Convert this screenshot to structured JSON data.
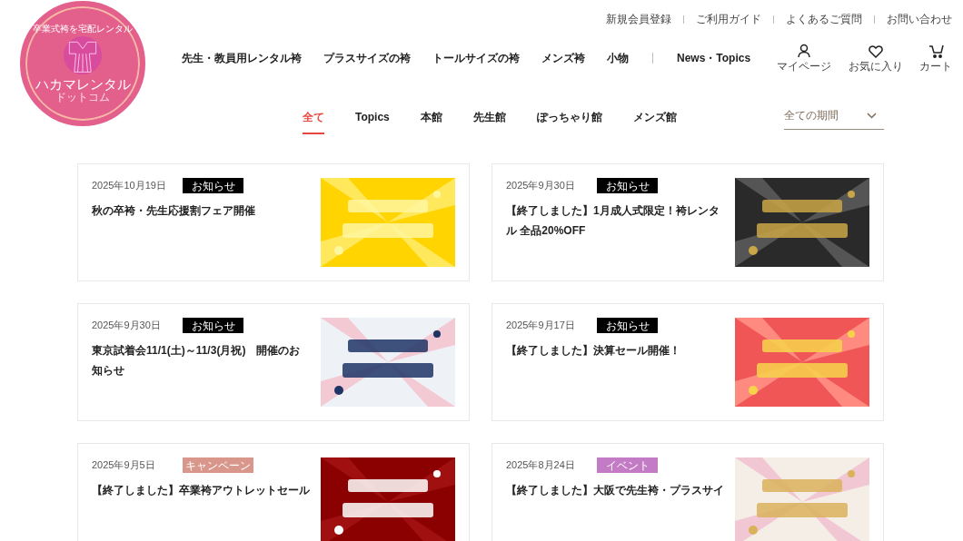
{
  "logo": {
    "tagline": "卒業式袴を宅配レンタル",
    "name": "ハカマレンタル",
    "sub": "ドットコム"
  },
  "utility_links": [
    "新規会員登録",
    "ご利用ガイド",
    "よくあるご質問",
    "お問い合わせ"
  ],
  "main_nav": [
    "先生・教員用レンタル袴",
    "プラスサイズの袴",
    "トールサイズの袴",
    "メンズ袴",
    "小物"
  ],
  "secondary_nav": [
    "News・Topics"
  ],
  "account_links": [
    {
      "kind": "account",
      "label": "マイページ"
    },
    {
      "kind": "favorites",
      "label": "お気に入り"
    },
    {
      "kind": "cart",
      "label": "カート"
    }
  ],
  "filter_tabs": [
    {
      "label": "全て",
      "selected": true
    },
    {
      "label": "Topics",
      "selected": false
    },
    {
      "label": "本館",
      "selected": false
    },
    {
      "label": "先生館",
      "selected": false
    },
    {
      "label": "ぽっちゃり館",
      "selected": false
    },
    {
      "label": "メンズ館",
      "selected": false
    }
  ],
  "period_select": {
    "value": "全ての期間"
  },
  "posts": [
    {
      "date": "2025年10月19日",
      "category": "お知らせ",
      "color": "#000000",
      "title": "秋の卒袴・先生応援割フェア開催"
    },
    {
      "date": "2025年9月30日",
      "category": "お知らせ",
      "color": "#000000",
      "title": "【終了しました】1月成人式限定！袴レンタル 全品20%OFF"
    },
    {
      "date": "2025年9月30日",
      "category": "お知らせ",
      "color": "#000000",
      "title": "東京試着会11/1(土)～11/3(月祝)　開催のお知らせ"
    },
    {
      "date": "2025年9月17日",
      "category": "お知らせ",
      "color": "#000000",
      "title": "【終了しました】決算セール開催！"
    },
    {
      "date": "2025年9月5日",
      "category": "キャンペーン",
      "color": "#d9968a",
      "title": "【終了しました】卒業袴アウトレットセール"
    },
    {
      "date": "2025年8月24日",
      "category": "イベント",
      "color": "#c27bc4",
      "title": "【終了しました】大阪で先生袴・プラスサイ"
    }
  ]
}
